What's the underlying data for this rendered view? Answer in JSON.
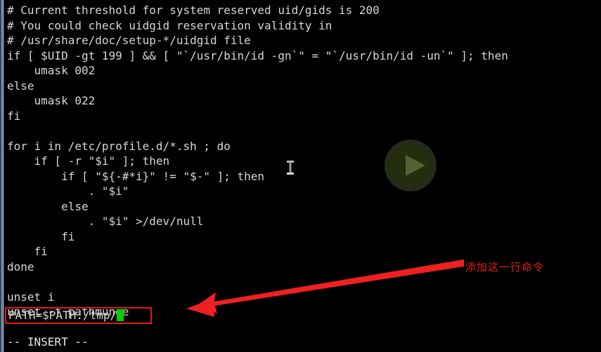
{
  "window": {
    "kind": "terminal",
    "background_color": "#000000",
    "text_color": "#d6d6d6"
  },
  "editor": {
    "mode_line": "-- INSERT --",
    "lines": [
      "# Current threshold for system reserved uid/gids is 200",
      "# You could check uidgid reservation validity in",
      "# /usr/share/doc/setup-*/uidgid file",
      "if [ $UID -gt 199 ] && [ \"`/usr/bin/id -gn`\" = \"`/usr/bin/id -un`\" ]; then",
      "    umask 002",
      "else",
      "    umask 022",
      "fi",
      "",
      "for i in /etc/profile.d/*.sh ; do",
      "    if [ -r \"$i\" ]; then",
      "        if [ \"${-#*i}\" != \"$-\" ]; then",
      "            . \"$i\"",
      "        else",
      "            . \"$i\" >/dev/null",
      "        fi",
      "    fi",
      "done",
      "",
      "unset i",
      "unset -f pathmunge"
    ],
    "highlighted_line": {
      "text": "PATH=$PATH:/tmp/",
      "box_color": "#e01b1b",
      "cursor_color": "#00d000",
      "cursor_shape": "block"
    }
  },
  "annotation": {
    "text": "添加这一行命令",
    "color": "#e02020",
    "arrow_color": "#ef2020"
  },
  "overlay": {
    "play_button_label": "play",
    "fill_color": "rgba(120,150,40,0.30)",
    "ring_color": "rgba(40,40,40,0.55)"
  },
  "pointer": {
    "shape": "i-beam"
  }
}
